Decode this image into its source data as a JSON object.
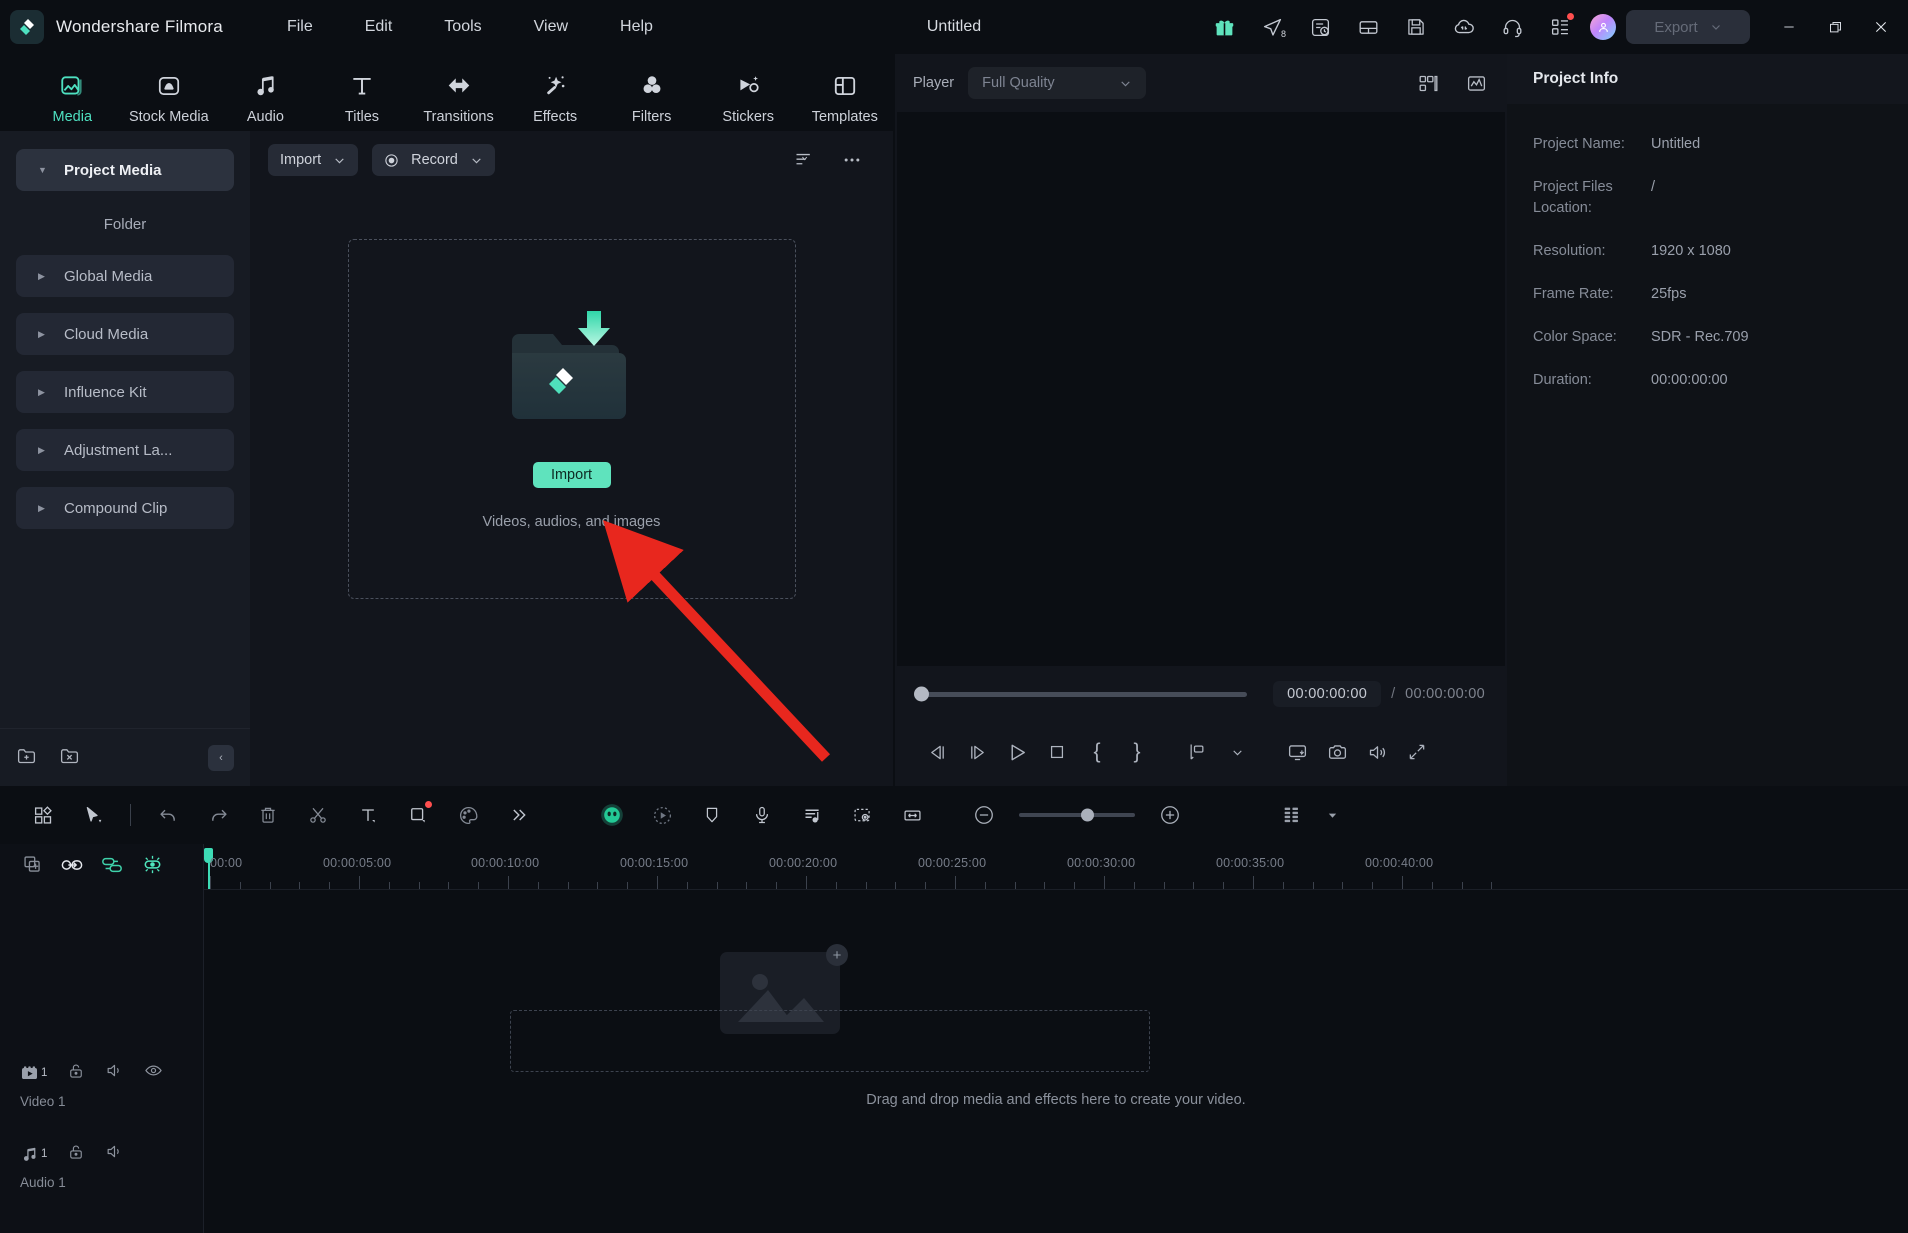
{
  "app": {
    "brand": "Wondershare Filmora",
    "document_title": "Untitled",
    "accent_teal": "#4ee0c0",
    "import_button_color": "#5fe3bd",
    "annotation_arrow_color": "#e8271e"
  },
  "menubar": {
    "items": [
      {
        "label": "File"
      },
      {
        "label": "Edit"
      },
      {
        "label": "Tools"
      },
      {
        "label": "View"
      },
      {
        "label": "Help"
      }
    ]
  },
  "titlebar_actions": {
    "icons": [
      {
        "name": "gift-icon"
      },
      {
        "name": "send-feedback-icon",
        "badge": "8"
      },
      {
        "name": "task-history-icon"
      },
      {
        "name": "layout-icon"
      },
      {
        "name": "save-icon"
      },
      {
        "name": "cloud-sync-icon"
      },
      {
        "name": "support-headset-icon"
      },
      {
        "name": "apps-grid-icon",
        "has_notification_dot": true
      }
    ],
    "avatar": "user-avatar",
    "export_label": "Export",
    "window_controls": [
      "minimize",
      "maximize",
      "close"
    ]
  },
  "category_tabs": {
    "active": "Media",
    "items": [
      {
        "label": "Media",
        "icon": "media-image-icon"
      },
      {
        "label": "Stock Media",
        "icon": "stock-folder-icon"
      },
      {
        "label": "Audio",
        "icon": "music-note-icon"
      },
      {
        "label": "Titles",
        "icon": "text-t-icon"
      },
      {
        "label": "Transitions",
        "icon": "transitions-arrows-icon"
      },
      {
        "label": "Effects",
        "icon": "effects-wand-icon"
      },
      {
        "label": "Filters",
        "icon": "filters-circles-icon"
      },
      {
        "label": "Stickers",
        "icon": "stickers-sparkle-icon"
      },
      {
        "label": "Templates",
        "icon": "templates-layout-icon"
      }
    ]
  },
  "media_sidebar": {
    "items": [
      {
        "label": "Project Media",
        "expanded": true,
        "selected": true
      },
      {
        "label": "Folder",
        "is_child": true
      },
      {
        "label": "Global Media",
        "expanded": false
      },
      {
        "label": "Cloud Media",
        "expanded": false
      },
      {
        "label": "Influence Kit",
        "expanded": false
      },
      {
        "label": "Adjustment La...",
        "expanded": false
      },
      {
        "label": "Compound Clip",
        "expanded": false
      }
    ],
    "footer_icons": [
      {
        "name": "new-folder-icon"
      },
      {
        "name": "delete-folder-icon"
      },
      {
        "name": "collapse-panel-icon"
      }
    ]
  },
  "media_toolbar": {
    "import_label": "Import",
    "record_label": "Record",
    "filter_icon": "filter-sort-icon",
    "more_icon": "more-options-icon"
  },
  "dropzone": {
    "import_button": "Import",
    "hint": "Videos, audios, and images"
  },
  "player": {
    "label": "Player",
    "quality": "Full Quality",
    "view_icons": [
      {
        "name": "split-view-icon"
      },
      {
        "name": "waveform-scope-icon"
      }
    ],
    "current_time": "00:00:00:00",
    "separator": "/",
    "total_time": "00:00:00:00",
    "controls": [
      {
        "name": "prev-frame-icon"
      },
      {
        "name": "next-frame-icon"
      },
      {
        "name": "play-icon"
      },
      {
        "name": "stop-icon"
      },
      {
        "name": "mark-in-icon",
        "glyph": "{"
      },
      {
        "name": "mark-out-icon",
        "glyph": "}"
      },
      {
        "name": "add-marker-icon"
      },
      {
        "name": "marker-dropdown-icon"
      },
      {
        "name": "render-preview-icon"
      },
      {
        "name": "snapshot-camera-icon"
      },
      {
        "name": "volume-icon"
      },
      {
        "name": "fullscreen-icon"
      }
    ]
  },
  "project_info": {
    "title": "Project Info",
    "rows": [
      {
        "key": "Project Name:",
        "value": "Untitled"
      },
      {
        "key": "Project Files Location:",
        "value": "/"
      },
      {
        "key": "Resolution:",
        "value": "1920 x 1080"
      },
      {
        "key": "Frame Rate:",
        "value": "25fps"
      },
      {
        "key": "Color Space:",
        "value": "SDR - Rec.709"
      },
      {
        "key": "Duration:",
        "value": "00:00:00:00"
      }
    ]
  },
  "timeline_toolbar": {
    "icons": [
      {
        "name": "templates-grid-icon"
      },
      {
        "name": "selection-pointer-icon"
      },
      {
        "name": "undo-icon"
      },
      {
        "name": "redo-icon"
      },
      {
        "name": "delete-trash-icon"
      },
      {
        "name": "split-scissors-icon"
      },
      {
        "name": "add-text-icon"
      },
      {
        "name": "crop-mask-icon",
        "has_notification_dot": true
      },
      {
        "name": "color-palette-icon"
      },
      {
        "name": "more-tools-icon"
      },
      {
        "name": "ai-avatar-icon",
        "active": true
      },
      {
        "name": "speed-ramping-icon"
      },
      {
        "name": "add-marker-icon"
      },
      {
        "name": "voiceover-mic-icon"
      },
      {
        "name": "audio-beat-icon"
      },
      {
        "name": "keyframe-mask-icon"
      },
      {
        "name": "fit-to-timeline-icon"
      },
      {
        "name": "zoom-out-icon"
      },
      {
        "name": "zoom-in-icon"
      },
      {
        "name": "track-manager-icon"
      },
      {
        "name": "track-manager-dropdown-icon"
      }
    ]
  },
  "timeline": {
    "head_controls": [
      {
        "name": "add-track-icon"
      },
      {
        "name": "link-clips-icon"
      },
      {
        "name": "auto-ripple-icon"
      },
      {
        "name": "magnetic-snap-icon",
        "active": true
      }
    ],
    "ruler_labels": [
      "00:00",
      "00:00:05:00",
      "00:00:10:00",
      "00:00:15:00",
      "00:00:20:00",
      "00:00:25:00",
      "00:00:30:00",
      "00:00:35:00",
      "00:00:40:00"
    ],
    "tracks": [
      {
        "label": "Video 1",
        "number": "1",
        "type_icon": "video-track-icon",
        "controls": [
          "unlock-icon",
          "mute-icon",
          "visibility-eye-icon"
        ]
      },
      {
        "label": "Audio 1",
        "number": "1",
        "type_icon": "audio-track-icon",
        "controls": [
          "unlock-icon",
          "mute-icon"
        ]
      }
    ],
    "empty_hint": "Drag and drop media and effects here to create your video."
  }
}
